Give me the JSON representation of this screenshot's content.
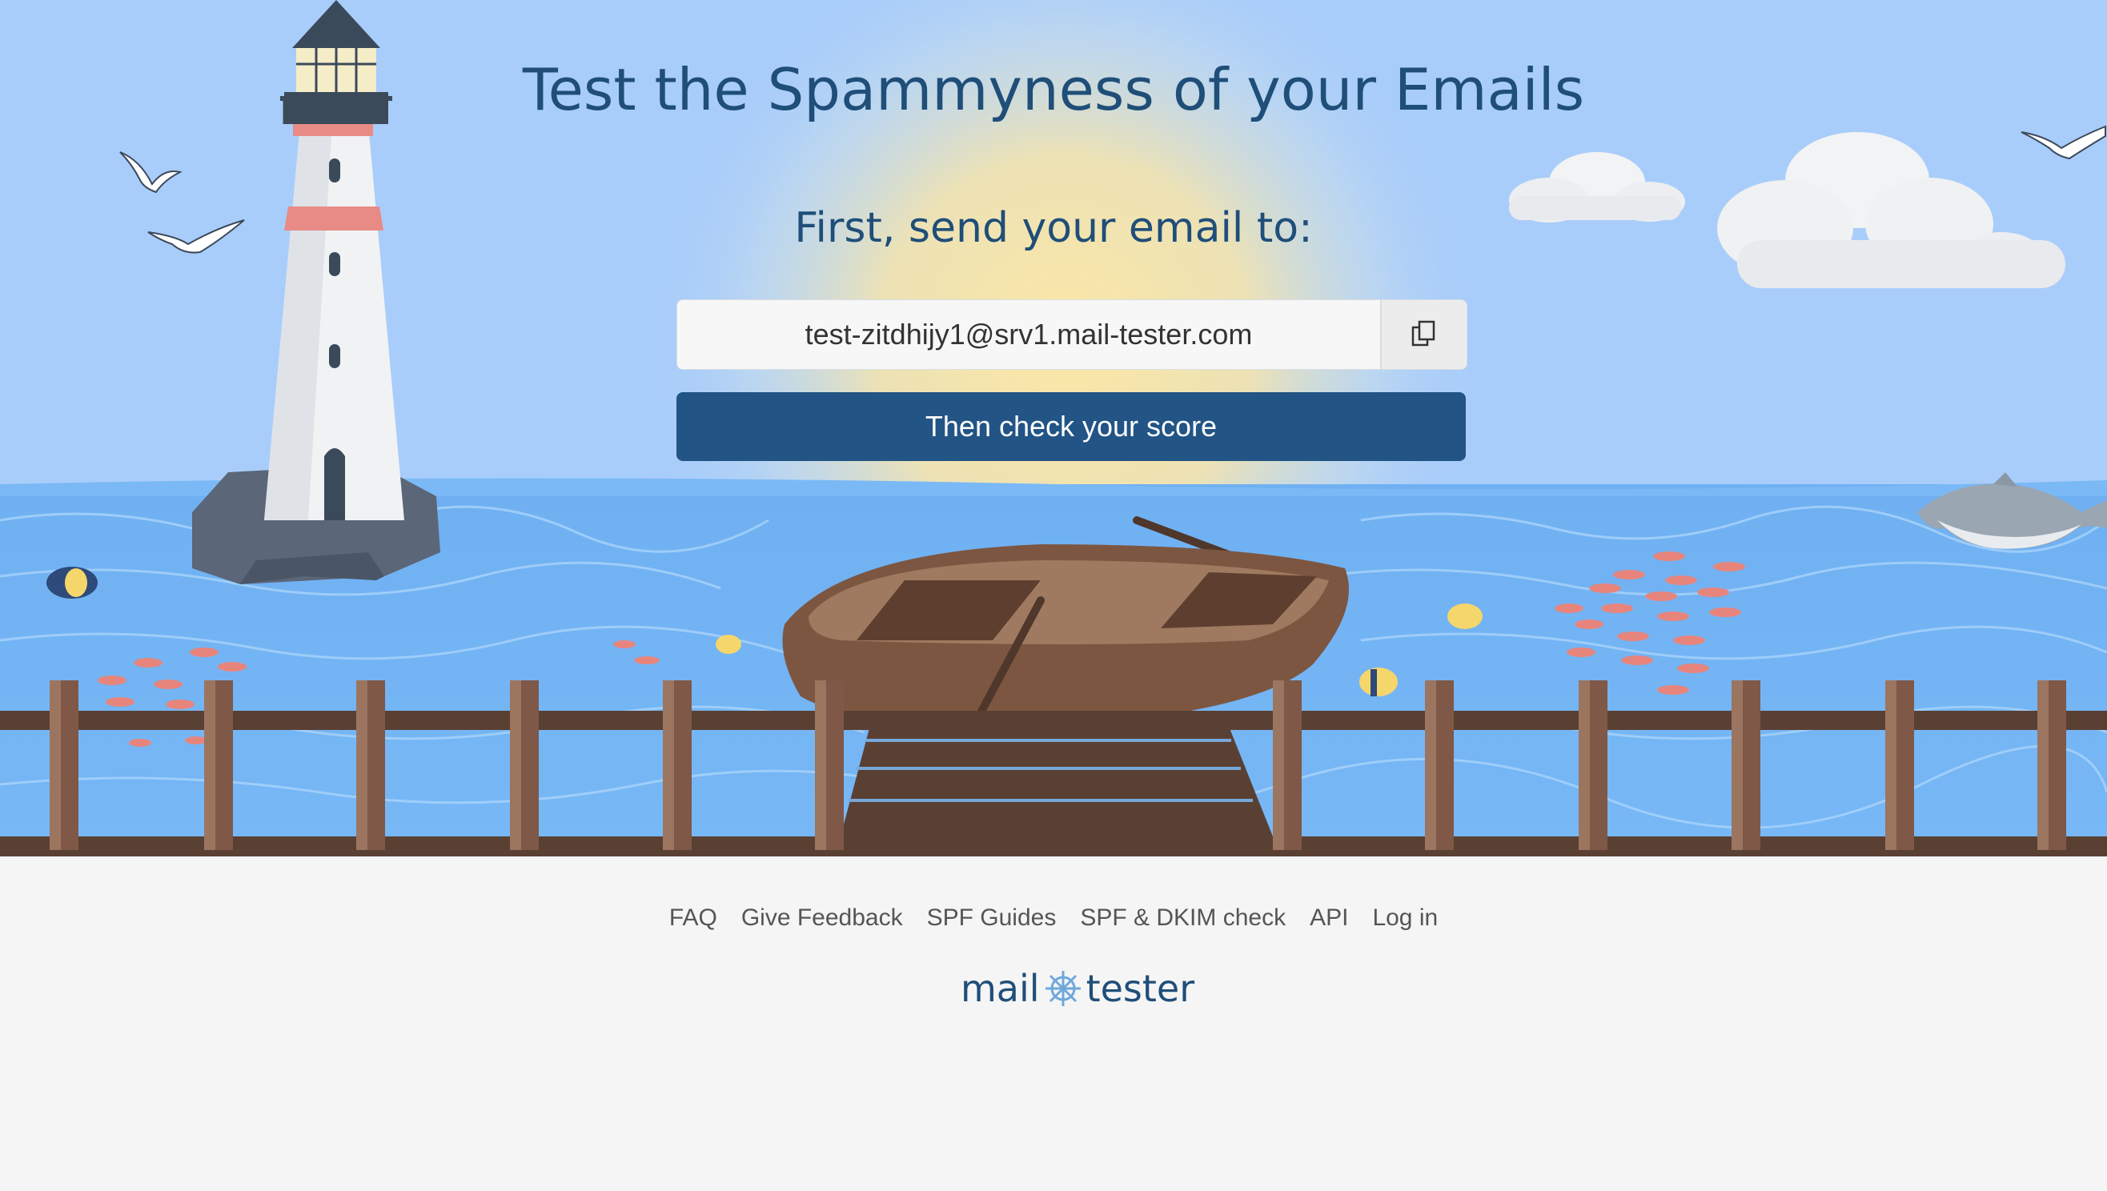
{
  "header": {
    "title": "Test the Spammyness of your Emails",
    "subtitle": "First, send your email to:"
  },
  "email": {
    "address": "test-zitdhijy1@srv1.mail-tester.com",
    "copy_icon": "copy-icon"
  },
  "actions": {
    "check_label": "Then check your score"
  },
  "footer": {
    "links": [
      "FAQ",
      "Give Feedback",
      "SPF Guides",
      "SPF & DKIM check",
      "API",
      "Log in"
    ],
    "logo_left": "mail",
    "logo_right": "tester",
    "logo_icon": "ship-wheel-icon"
  },
  "colors": {
    "primary": "#225485",
    "heading": "#1f4e79",
    "sky": "#a9cdfa",
    "sea": "#71b1f3",
    "dock": "#6b4a3a"
  }
}
